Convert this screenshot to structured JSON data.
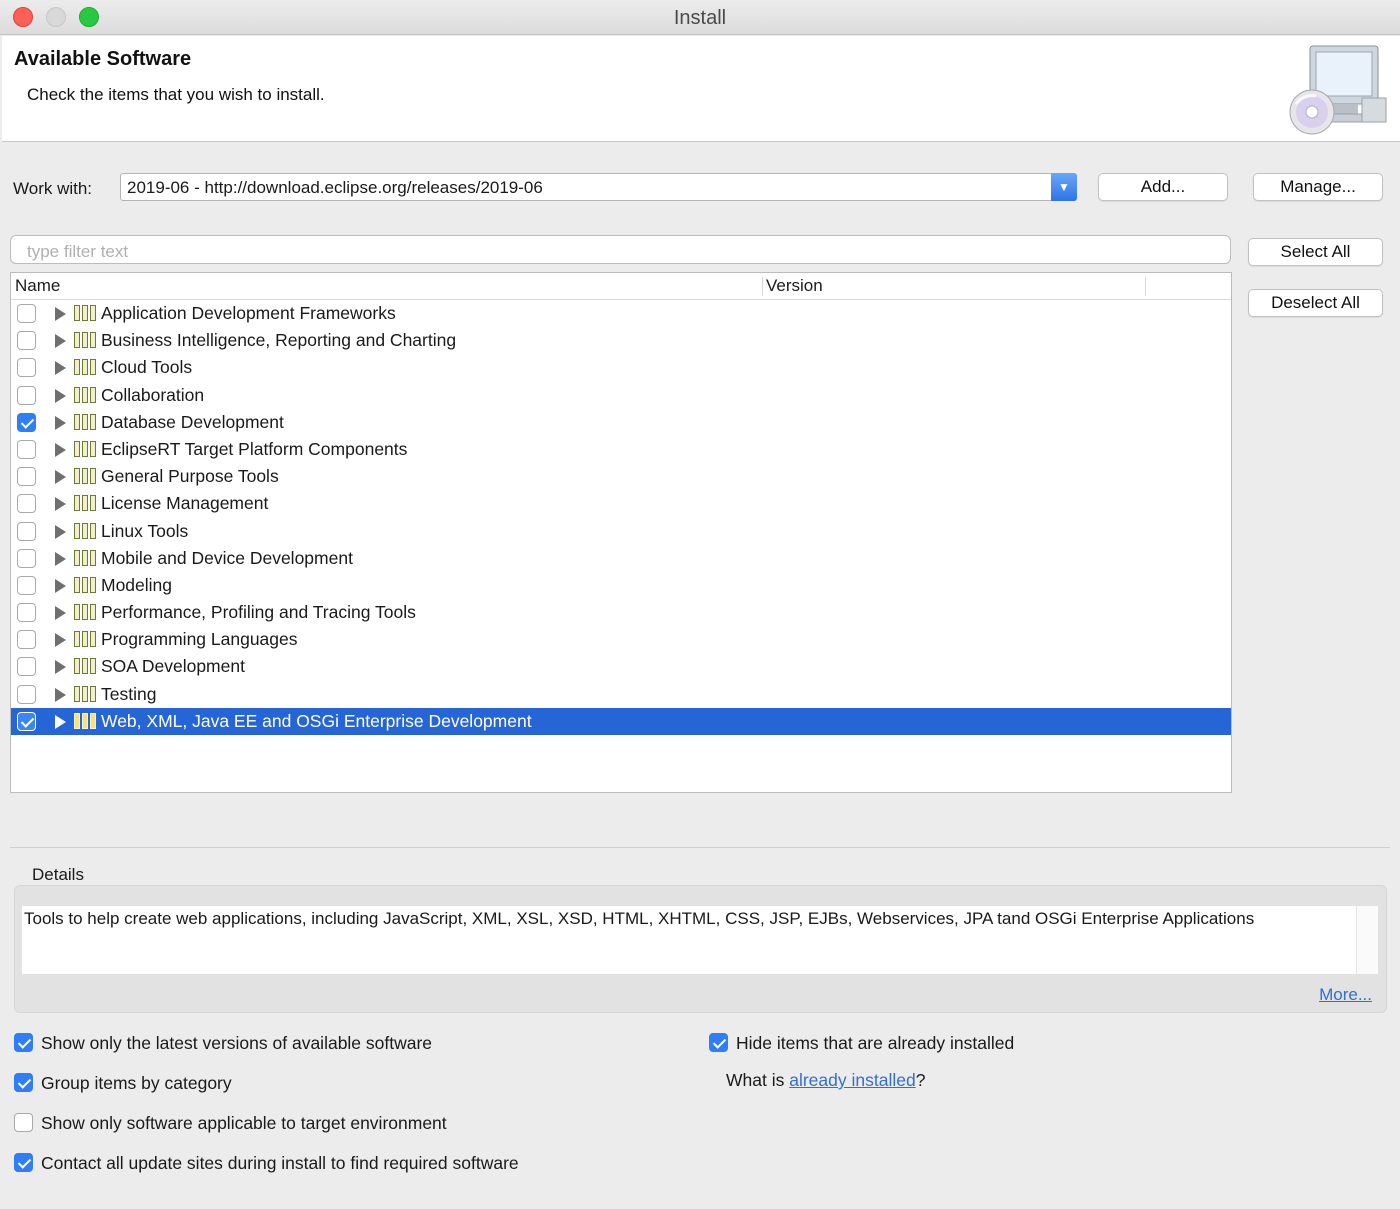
{
  "window": {
    "title": "Install"
  },
  "banner": {
    "title": "Available Software",
    "subtitle": "Check the items that you wish to install.",
    "icon": "install-cd-monitor-icon"
  },
  "work_with": {
    "label": "Work with:",
    "value": "2019-06 - http://download.eclipse.org/releases/2019-06",
    "add_label": "Add...",
    "manage_label": "Manage..."
  },
  "filter": {
    "placeholder": "type filter text"
  },
  "buttons": {
    "select_all": "Select All",
    "deselect_all": "Deselect All"
  },
  "table": {
    "columns": [
      "Name",
      "Version"
    ],
    "rows": [
      {
        "label": "Application Development Frameworks",
        "checked": false,
        "selected": false
      },
      {
        "label": "Business Intelligence, Reporting and Charting",
        "checked": false,
        "selected": false
      },
      {
        "label": "Cloud Tools",
        "checked": false,
        "selected": false
      },
      {
        "label": "Collaboration",
        "checked": false,
        "selected": false
      },
      {
        "label": "Database Development",
        "checked": true,
        "selected": false
      },
      {
        "label": "EclipseRT Target Platform Components",
        "checked": false,
        "selected": false
      },
      {
        "label": "General Purpose Tools",
        "checked": false,
        "selected": false
      },
      {
        "label": "License Management",
        "checked": false,
        "selected": false
      },
      {
        "label": "Linux Tools",
        "checked": false,
        "selected": false
      },
      {
        "label": "Mobile and Device Development",
        "checked": false,
        "selected": false
      },
      {
        "label": "Modeling",
        "checked": false,
        "selected": false
      },
      {
        "label": "Performance, Profiling and Tracing Tools",
        "checked": false,
        "selected": false
      },
      {
        "label": "Programming Languages",
        "checked": false,
        "selected": false
      },
      {
        "label": "SOA Development",
        "checked": false,
        "selected": false
      },
      {
        "label": "Testing",
        "checked": false,
        "selected": false
      },
      {
        "label": "Web, XML, Java EE and OSGi Enterprise Development",
        "checked": true,
        "selected": true
      }
    ]
  },
  "details": {
    "label": "Details",
    "text": "Tools to help create web applications, including JavaScript, XML, XSL, XSD, HTML, XHTML, CSS, JSP, EJBs, Webservices, JPA tand OSGi Enterprise Applications",
    "more_label": "More..."
  },
  "options": {
    "latest_versions": {
      "label": "Show only the latest versions of available software",
      "checked": true
    },
    "group_by_category": {
      "label": "Group items by category",
      "checked": true
    },
    "target_env": {
      "label": "Show only software applicable to target environment",
      "checked": false
    },
    "contact_sites": {
      "label": "Contact all update sites during install to find required software",
      "checked": true
    },
    "hide_installed": {
      "label": "Hide items that are already installed",
      "checked": true
    }
  },
  "what_is": {
    "prefix": "What is ",
    "link": "already installed",
    "suffix": "?"
  },
  "colors": {
    "selection": "#2665d6",
    "checkbox_checked": "#2f7ef6",
    "link": "#2f6fd6"
  }
}
